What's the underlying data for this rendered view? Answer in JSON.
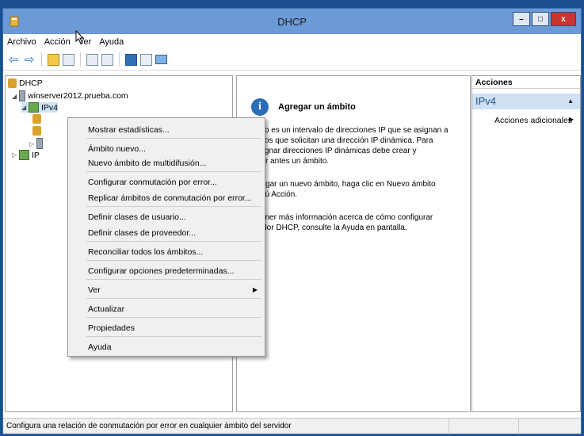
{
  "window": {
    "title": "DHCP"
  },
  "window_buttons": {
    "minimize": "–",
    "maximize": "□",
    "close": "x"
  },
  "menu": [
    "Archivo",
    "Acción",
    "Ver",
    "Ayuda"
  ],
  "tree": {
    "root": "DHCP",
    "server": "winserver2012.prueba.com",
    "ipv4": "IPv4",
    "ipv6_partial": "IP"
  },
  "content": {
    "title": "Agregar un ámbito",
    "paragraphs": [
      "mbito es un intervalo de direcciones IP que se asignan a\nquipos que solicitan una dirección IP dinámica. Para\nr asignar direcciones IP dinámicas debe crear y\ngurar antes un ámbito.",
      "agregar un nuevo ámbito, haga clic en Nuevo ámbito\nmenú Acción.",
      "obtener más información acerca de cómo configurar\nervidor DHCP, consulte la Ayuda en pantalla."
    ]
  },
  "actions": {
    "header": "Acciones",
    "section": "IPv4",
    "item": "Acciones adicionales"
  },
  "context_menu": [
    "Mostrar estadísticas...",
    "Ámbito nuevo...",
    "Nuevo ámbito de multidifusión...",
    "Configurar conmutación por error...",
    "Replicar ámbitos de conmutación por error...",
    "Definir clases de usuario...",
    "Definir clases de proveedor...",
    "Reconciliar todos los ámbitos...",
    "Configurar opciones predeterminadas...",
    "Ver",
    "Actualizar",
    "Propiedades",
    "Ayuda"
  ],
  "statusbar": {
    "text": "Configura una relación de conmutación por error en cualquier ámbito del servidor"
  },
  "colors": {
    "titlebar": "#6b9ad6",
    "close_button": "#c7372f",
    "actions_section": "#cfe1f3",
    "desktop": "#1a4f8f"
  },
  "icons": [
    "dhcp-icon",
    "back-arrow-icon",
    "forward-arrow-icon",
    "up-folder-icon",
    "show-hide-tree-icon",
    "properties-icon",
    "refresh-icon",
    "help-icon",
    "mmc-icon",
    "monitor-icon",
    "info-icon"
  ]
}
